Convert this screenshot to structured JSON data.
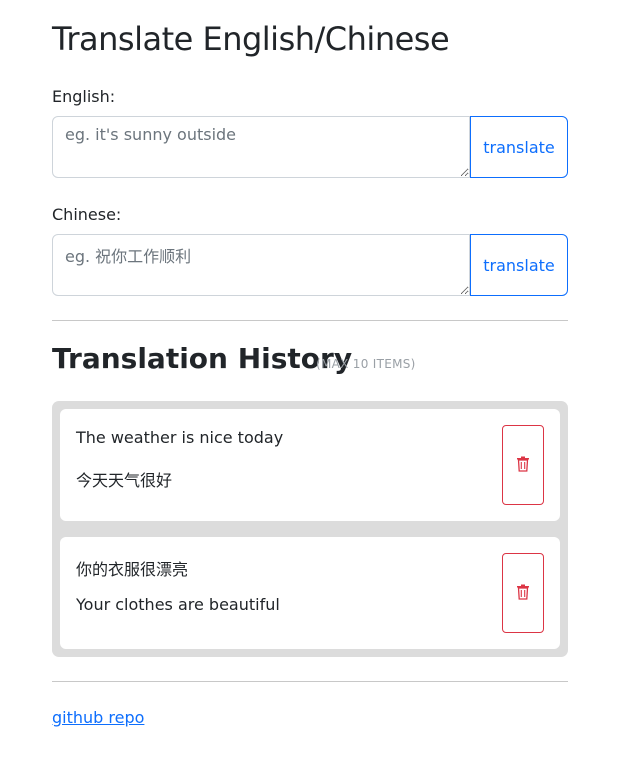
{
  "header": {
    "title": "Translate English/Chinese"
  },
  "english": {
    "label": "English:",
    "placeholder": "eg. it's sunny outside",
    "value": "",
    "button_label": "translate"
  },
  "chinese": {
    "label": "Chinese:",
    "placeholder": "eg. 祝你工作顺利",
    "value": "",
    "button_label": "translate"
  },
  "history": {
    "title": "Translation History",
    "subtitle": "(MAX 10 ITEMS)",
    "items": [
      {
        "source": "The weather is nice today",
        "translation": "今天天气很好"
      },
      {
        "source": "你的衣服很漂亮",
        "translation": "Your clothes are beautiful"
      }
    ]
  },
  "footer": {
    "link_label": "github repo"
  },
  "colors": {
    "accent": "#0d6efd",
    "danger": "#dc3545",
    "panel": "#dcdcdc"
  },
  "icons": {
    "delete": "trash-icon"
  }
}
